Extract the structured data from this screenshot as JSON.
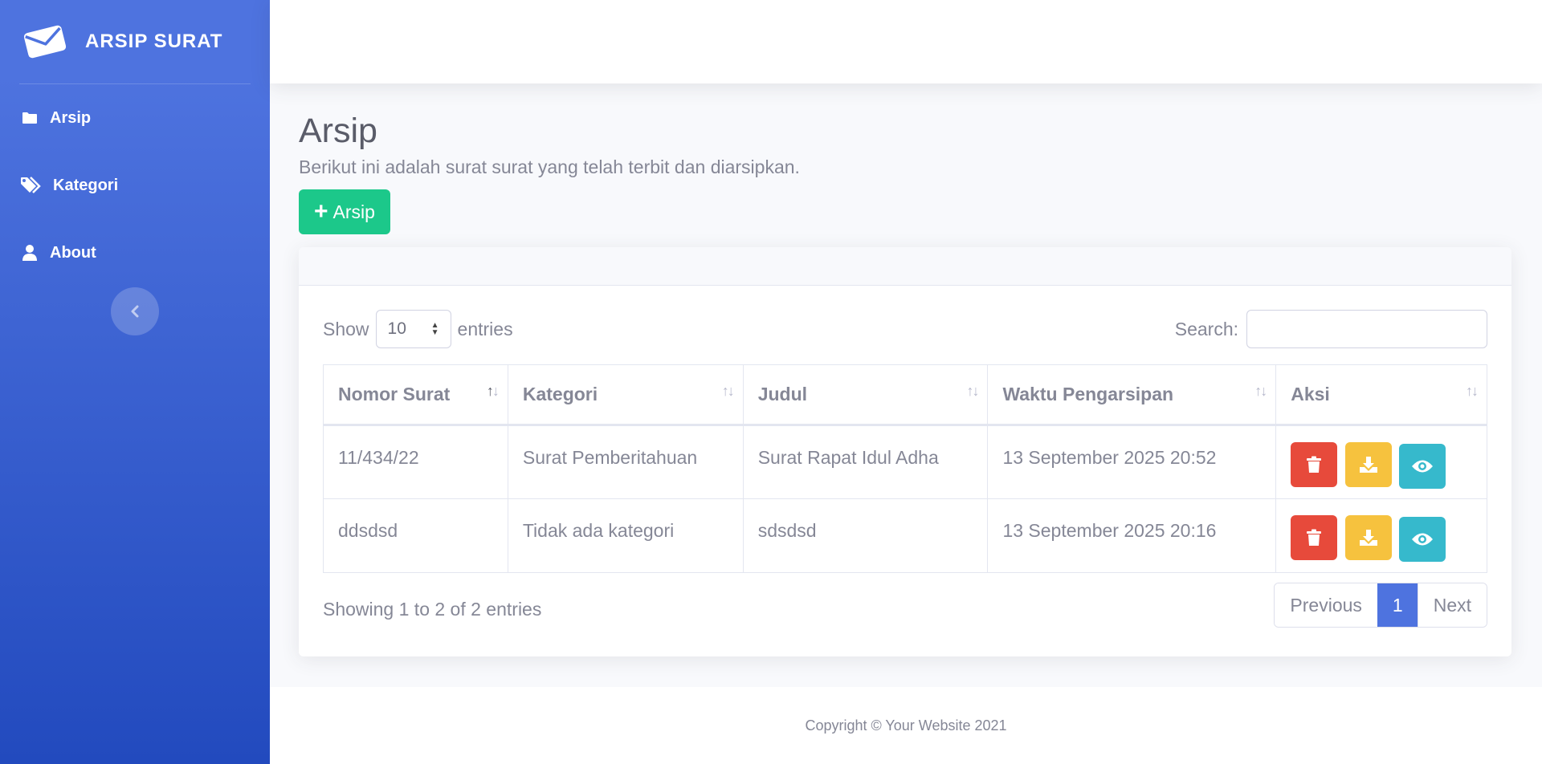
{
  "sidebar": {
    "brand": "ARSIP SURAT",
    "items": [
      {
        "label": "Arsip",
        "icon": "folder-icon"
      },
      {
        "label": "Kategori",
        "icon": "tags-icon"
      },
      {
        "label": "About",
        "icon": "user-icon"
      }
    ]
  },
  "main": {
    "title": "Arsip",
    "subtitle": "Berikut ini adalah surat surat yang telah terbit dan diarsipkan.",
    "add_button": "Arsip"
  },
  "table": {
    "show_label": "Show",
    "entries_label": "entries",
    "page_length": "10",
    "search_label": "Search:",
    "search_value": "",
    "columns": [
      "Nomor Surat",
      "Kategori",
      "Judul",
      "Waktu Pengarsipan",
      "Aksi"
    ],
    "rows": [
      {
        "nomor": "11/434/22",
        "kategori": "Surat Pemberitahuan",
        "judul": "Surat Rapat Idul Adha",
        "waktu": "13 September 2025 20:52"
      },
      {
        "nomor": "ddsdsd",
        "kategori": "Tidak ada kategori",
        "judul": "sdsdsd",
        "waktu": "13 September 2025 20:16"
      }
    ],
    "info": "Showing 1 to 2 of 2 entries",
    "pagination": {
      "previous": "Previous",
      "current": "1",
      "next": "Next"
    }
  },
  "footer": {
    "copyright": "Copyright © Your Website 2021"
  },
  "colors": {
    "primary": "#4e73df",
    "success": "#1cc88a",
    "danger": "#e74a3b",
    "warning": "#f6c23e",
    "info": "#36b9cc"
  }
}
